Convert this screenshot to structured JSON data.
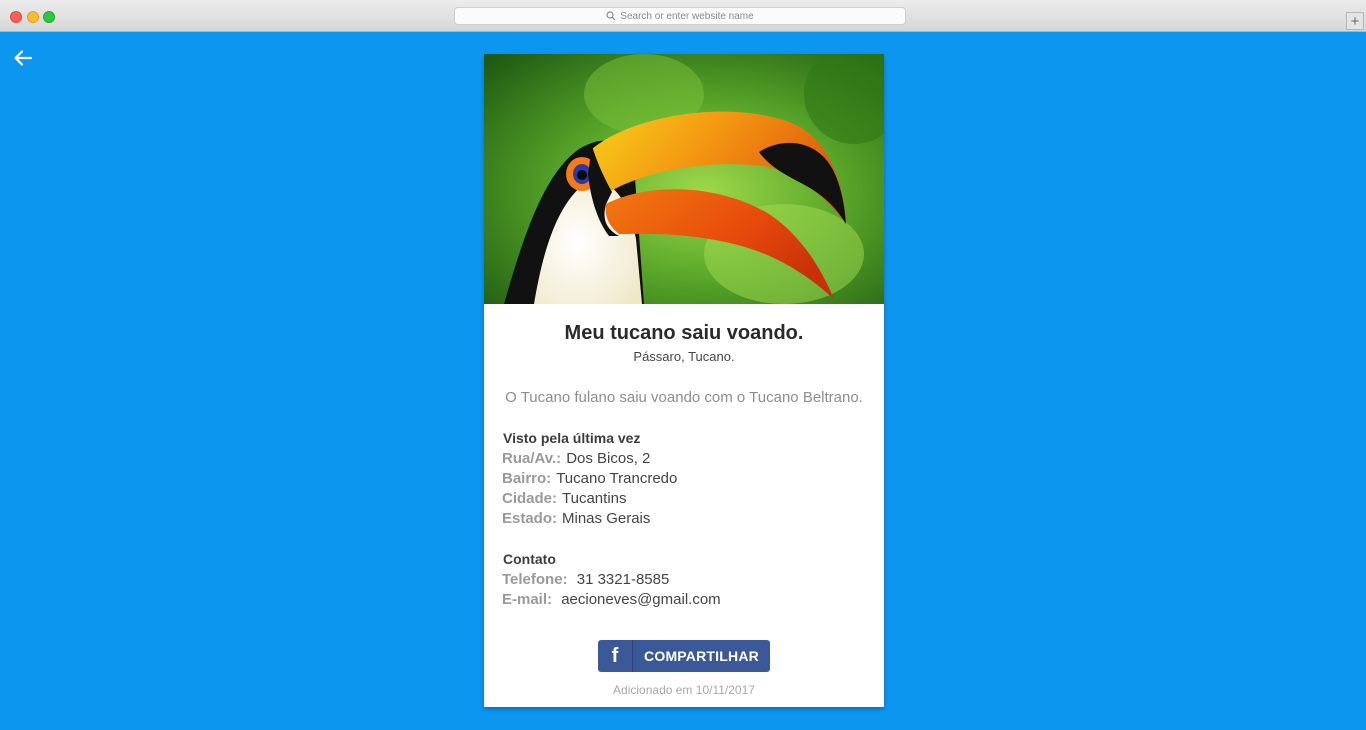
{
  "browser": {
    "address_placeholder": "Search or enter website name",
    "icons": [
      "search-icon",
      "plus-icon"
    ]
  },
  "nav": {
    "back_icon": "arrow-left-icon"
  },
  "colors": {
    "background": "#0d96f0",
    "card": "#ffffff",
    "facebook": "#3b5998"
  },
  "post": {
    "image_alt": "Toucan photo",
    "title": "Meu tucano saiu voando.",
    "tags": "Pássaro, Tucano.",
    "description": "O Tucano fulano saiu voando com o Tucano Beltrano.",
    "last_seen": {
      "heading": "Visto pela última vez",
      "fields": [
        {
          "label": "Rua/Av.:",
          "value": "Dos Bicos, 2"
        },
        {
          "label": "Bairro:",
          "value": "Tucano Trancredo"
        },
        {
          "label": "Cidade:",
          "value": "Tucantins"
        },
        {
          "label": "Estado:",
          "value": "Minas Gerais"
        }
      ]
    },
    "contact": {
      "heading": "Contato",
      "fields": [
        {
          "label": "Telefone:",
          "value": "31 3321-8585"
        },
        {
          "label": "E-mail:",
          "value": "aecioneves@gmail.com"
        }
      ]
    },
    "share_button": {
      "icon": "f",
      "label": "COMPARTILHAR"
    },
    "added": "Adicionado em 10/11/2017"
  }
}
